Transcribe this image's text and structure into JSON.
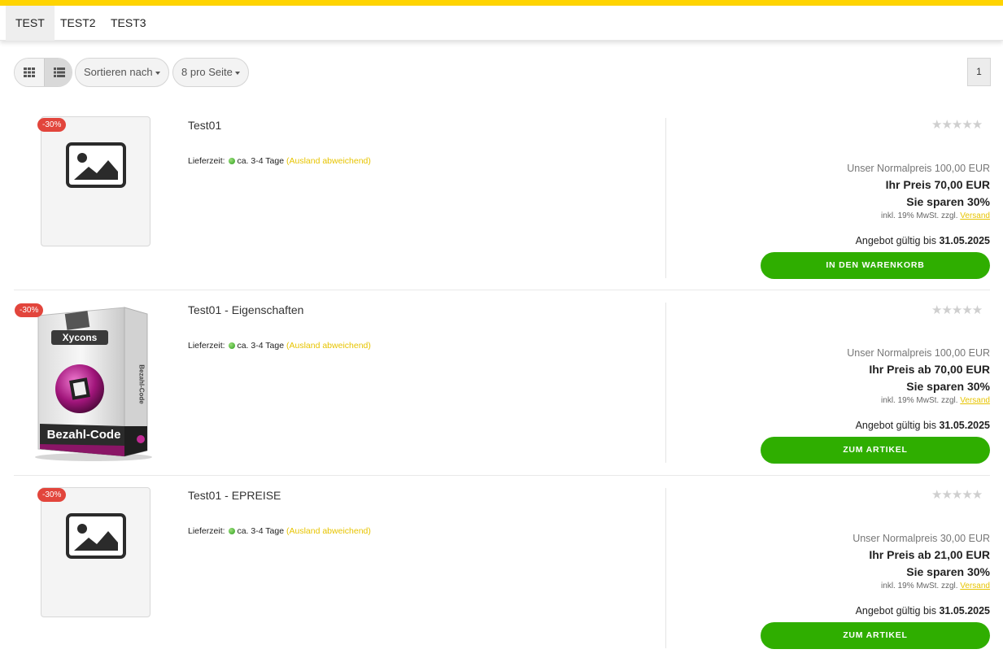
{
  "colors": {
    "accent": "#ffd400",
    "cta": "#2fae00",
    "badge": "#e2453c",
    "link": "#e7c400"
  },
  "nav": {
    "tabs": [
      {
        "label": "TEST"
      },
      {
        "label": "TEST2"
      },
      {
        "label": "TEST3"
      }
    ]
  },
  "toolbar": {
    "grid_icon": "grid-icon",
    "list_icon": "list-icon",
    "sort_label": "Sortieren nach",
    "per_page_label": "8 pro Seite",
    "page": "1"
  },
  "products": [
    {
      "badge": "-30%",
      "title": "Test01",
      "delivery_label": "Lieferzeit:",
      "delivery_time": "ca. 3-4 Tage",
      "delivery_note": "(Ausland abweichend)",
      "stars": "★★★★★",
      "normal_price": "Unser Normalpreis 100,00 EUR",
      "your_price": "Ihr Preis 70,00 EUR",
      "saving": "Sie sparen 30%",
      "tax_text": "inkl. 19% MwSt. zzgl.",
      "shipping_link": "Versand",
      "offer_label": "Angebot gültig bis",
      "offer_date": "31.05.2025",
      "button": "IN DEN WARENKORB",
      "image": "placeholder-image-icon"
    },
    {
      "badge": "-30%",
      "title": "Test01 - Eigenschaften",
      "delivery_label": "Lieferzeit:",
      "delivery_time": "ca. 3-4 Tage",
      "delivery_note": "(Ausland abweichend)",
      "stars": "★★★★★",
      "normal_price": "Unser Normalpreis 100,00 EUR",
      "your_price": "Ihr Preis ab 70,00 EUR",
      "saving": "Sie sparen 30%",
      "tax_text": "inkl. 19% MwSt. zzgl.",
      "shipping_link": "Versand",
      "offer_label": "Angebot gültig bis",
      "offer_date": "31.05.2025",
      "button": "ZUM ARTIKEL",
      "image": "xycons-box-image",
      "box_brand": "Xycons",
      "box_title": "Bezahl-Code",
      "box_side": "Bezahl-Code"
    },
    {
      "badge": "-30%",
      "title": "Test01 - EPREISE",
      "delivery_label": "Lieferzeit:",
      "delivery_time": "ca. 3-4 Tage",
      "delivery_note": "(Ausland abweichend)",
      "stars": "★★★★★",
      "normal_price": "Unser Normalpreis 30,00 EUR",
      "your_price": "Ihr Preis ab 21,00 EUR",
      "saving": "Sie sparen 30%",
      "tax_text": "inkl. 19% MwSt. zzgl.",
      "shipping_link": "Versand",
      "offer_label": "Angebot gültig bis",
      "offer_date": "31.05.2025",
      "button": "ZUM ARTIKEL",
      "image": "placeholder-image-icon"
    }
  ]
}
